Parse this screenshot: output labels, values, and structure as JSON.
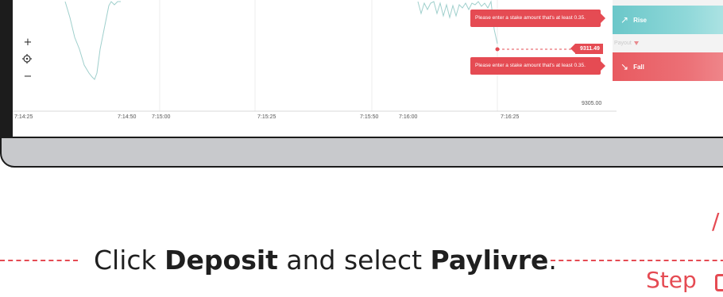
{
  "chart": {
    "zoom_in": "+",
    "recenter_icon": "crosshair-icon",
    "zoom_out": "−",
    "time_ticks": [
      "7:14:25",
      "7:14:50",
      "7:15:00",
      "7:15:25",
      "7:15:50",
      "7:16:00",
      "7:16:25"
    ],
    "price_label": "9305.00",
    "current_price": "9311.49",
    "line_color": "#9fcfcc",
    "accent_color": "#e54b53"
  },
  "errors": {
    "rise_error": "Please enter a stake amount that's at least 0.35.",
    "fall_error": "Please enter a stake amount that's at least 0.35."
  },
  "trade": {
    "rise_label": "Rise",
    "payout_label": "Payout",
    "fall_label": "Fall",
    "rise_color": "#6bc7c9",
    "fall_color": "#e85a60"
  },
  "instruction": {
    "prefix": "Click ",
    "deposit": "Deposit",
    "middle": " and select ",
    "method": "Paylivre",
    "suffix": "."
  },
  "step": {
    "label": "Step"
  }
}
